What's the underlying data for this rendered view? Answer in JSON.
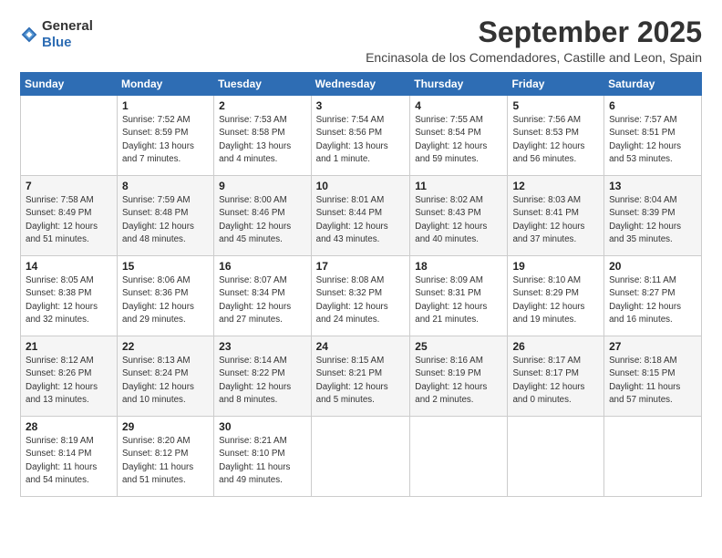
{
  "logo": {
    "general": "General",
    "blue": "Blue"
  },
  "title": "September 2025",
  "subtitle": "Encinasola de los Comendadores, Castille and Leon, Spain",
  "weekdays": [
    "Sunday",
    "Monday",
    "Tuesday",
    "Wednesday",
    "Thursday",
    "Friday",
    "Saturday"
  ],
  "weeks": [
    [
      {
        "day": "",
        "sunrise": "",
        "sunset": "",
        "daylight": ""
      },
      {
        "day": "1",
        "sunrise": "Sunrise: 7:52 AM",
        "sunset": "Sunset: 8:59 PM",
        "daylight": "Daylight: 13 hours and 7 minutes."
      },
      {
        "day": "2",
        "sunrise": "Sunrise: 7:53 AM",
        "sunset": "Sunset: 8:58 PM",
        "daylight": "Daylight: 13 hours and 4 minutes."
      },
      {
        "day": "3",
        "sunrise": "Sunrise: 7:54 AM",
        "sunset": "Sunset: 8:56 PM",
        "daylight": "Daylight: 13 hours and 1 minute."
      },
      {
        "day": "4",
        "sunrise": "Sunrise: 7:55 AM",
        "sunset": "Sunset: 8:54 PM",
        "daylight": "Daylight: 12 hours and 59 minutes."
      },
      {
        "day": "5",
        "sunrise": "Sunrise: 7:56 AM",
        "sunset": "Sunset: 8:53 PM",
        "daylight": "Daylight: 12 hours and 56 minutes."
      },
      {
        "day": "6",
        "sunrise": "Sunrise: 7:57 AM",
        "sunset": "Sunset: 8:51 PM",
        "daylight": "Daylight: 12 hours and 53 minutes."
      }
    ],
    [
      {
        "day": "7",
        "sunrise": "Sunrise: 7:58 AM",
        "sunset": "Sunset: 8:49 PM",
        "daylight": "Daylight: 12 hours and 51 minutes."
      },
      {
        "day": "8",
        "sunrise": "Sunrise: 7:59 AM",
        "sunset": "Sunset: 8:48 PM",
        "daylight": "Daylight: 12 hours and 48 minutes."
      },
      {
        "day": "9",
        "sunrise": "Sunrise: 8:00 AM",
        "sunset": "Sunset: 8:46 PM",
        "daylight": "Daylight: 12 hours and 45 minutes."
      },
      {
        "day": "10",
        "sunrise": "Sunrise: 8:01 AM",
        "sunset": "Sunset: 8:44 PM",
        "daylight": "Daylight: 12 hours and 43 minutes."
      },
      {
        "day": "11",
        "sunrise": "Sunrise: 8:02 AM",
        "sunset": "Sunset: 8:43 PM",
        "daylight": "Daylight: 12 hours and 40 minutes."
      },
      {
        "day": "12",
        "sunrise": "Sunrise: 8:03 AM",
        "sunset": "Sunset: 8:41 PM",
        "daylight": "Daylight: 12 hours and 37 minutes."
      },
      {
        "day": "13",
        "sunrise": "Sunrise: 8:04 AM",
        "sunset": "Sunset: 8:39 PM",
        "daylight": "Daylight: 12 hours and 35 minutes."
      }
    ],
    [
      {
        "day": "14",
        "sunrise": "Sunrise: 8:05 AM",
        "sunset": "Sunset: 8:38 PM",
        "daylight": "Daylight: 12 hours and 32 minutes."
      },
      {
        "day": "15",
        "sunrise": "Sunrise: 8:06 AM",
        "sunset": "Sunset: 8:36 PM",
        "daylight": "Daylight: 12 hours and 29 minutes."
      },
      {
        "day": "16",
        "sunrise": "Sunrise: 8:07 AM",
        "sunset": "Sunset: 8:34 PM",
        "daylight": "Daylight: 12 hours and 27 minutes."
      },
      {
        "day": "17",
        "sunrise": "Sunrise: 8:08 AM",
        "sunset": "Sunset: 8:32 PM",
        "daylight": "Daylight: 12 hours and 24 minutes."
      },
      {
        "day": "18",
        "sunrise": "Sunrise: 8:09 AM",
        "sunset": "Sunset: 8:31 PM",
        "daylight": "Daylight: 12 hours and 21 minutes."
      },
      {
        "day": "19",
        "sunrise": "Sunrise: 8:10 AM",
        "sunset": "Sunset: 8:29 PM",
        "daylight": "Daylight: 12 hours and 19 minutes."
      },
      {
        "day": "20",
        "sunrise": "Sunrise: 8:11 AM",
        "sunset": "Sunset: 8:27 PM",
        "daylight": "Daylight: 12 hours and 16 minutes."
      }
    ],
    [
      {
        "day": "21",
        "sunrise": "Sunrise: 8:12 AM",
        "sunset": "Sunset: 8:26 PM",
        "daylight": "Daylight: 12 hours and 13 minutes."
      },
      {
        "day": "22",
        "sunrise": "Sunrise: 8:13 AM",
        "sunset": "Sunset: 8:24 PM",
        "daylight": "Daylight: 12 hours and 10 minutes."
      },
      {
        "day": "23",
        "sunrise": "Sunrise: 8:14 AM",
        "sunset": "Sunset: 8:22 PM",
        "daylight": "Daylight: 12 hours and 8 minutes."
      },
      {
        "day": "24",
        "sunrise": "Sunrise: 8:15 AM",
        "sunset": "Sunset: 8:21 PM",
        "daylight": "Daylight: 12 hours and 5 minutes."
      },
      {
        "day": "25",
        "sunrise": "Sunrise: 8:16 AM",
        "sunset": "Sunset: 8:19 PM",
        "daylight": "Daylight: 12 hours and 2 minutes."
      },
      {
        "day": "26",
        "sunrise": "Sunrise: 8:17 AM",
        "sunset": "Sunset: 8:17 PM",
        "daylight": "Daylight: 12 hours and 0 minutes."
      },
      {
        "day": "27",
        "sunrise": "Sunrise: 8:18 AM",
        "sunset": "Sunset: 8:15 PM",
        "daylight": "Daylight: 11 hours and 57 minutes."
      }
    ],
    [
      {
        "day": "28",
        "sunrise": "Sunrise: 8:19 AM",
        "sunset": "Sunset: 8:14 PM",
        "daylight": "Daylight: 11 hours and 54 minutes."
      },
      {
        "day": "29",
        "sunrise": "Sunrise: 8:20 AM",
        "sunset": "Sunset: 8:12 PM",
        "daylight": "Daylight: 11 hours and 51 minutes."
      },
      {
        "day": "30",
        "sunrise": "Sunrise: 8:21 AM",
        "sunset": "Sunset: 8:10 PM",
        "daylight": "Daylight: 11 hours and 49 minutes."
      },
      {
        "day": "",
        "sunrise": "",
        "sunset": "",
        "daylight": ""
      },
      {
        "day": "",
        "sunrise": "",
        "sunset": "",
        "daylight": ""
      },
      {
        "day": "",
        "sunrise": "",
        "sunset": "",
        "daylight": ""
      },
      {
        "day": "",
        "sunrise": "",
        "sunset": "",
        "daylight": ""
      }
    ]
  ]
}
